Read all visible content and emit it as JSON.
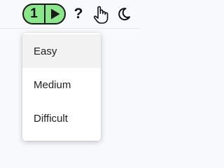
{
  "toolbar": {
    "level_number": "1",
    "level_color": "#8be58b",
    "help_label": "?",
    "icons": [
      "play-icon",
      "help-icon",
      "hand-pointer-icon",
      "moon-icon"
    ]
  },
  "difficulty_menu": {
    "selected": "Easy",
    "items": [
      {
        "label": "Easy"
      },
      {
        "label": "Medium"
      },
      {
        "label": "Difficult"
      }
    ]
  }
}
